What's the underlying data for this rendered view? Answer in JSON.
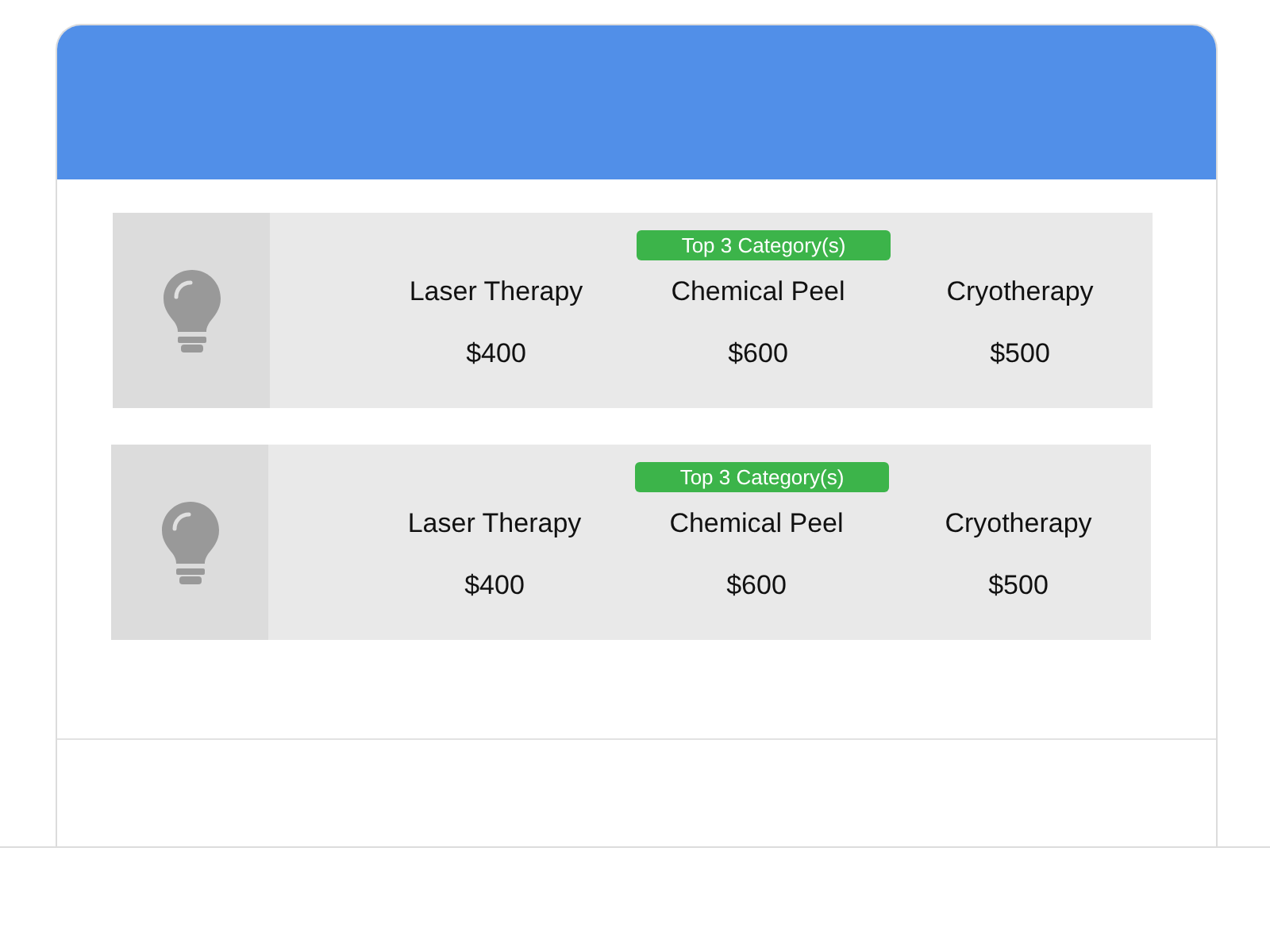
{
  "rows": [
    {
      "badge": "Top 3 Category(s)",
      "items": [
        {
          "name": "Laser Therapy",
          "price": "$400"
        },
        {
          "name": "Chemical Peel",
          "price": "$600"
        },
        {
          "name": "Cryotherapy",
          "price": "$500"
        }
      ]
    },
    {
      "badge": "Top 3 Category(s)",
      "items": [
        {
          "name": "Laser Therapy",
          "price": "$400"
        },
        {
          "name": "Chemical Peel",
          "price": "$600"
        },
        {
          "name": "Cryotherapy",
          "price": "$500"
        }
      ]
    }
  ]
}
